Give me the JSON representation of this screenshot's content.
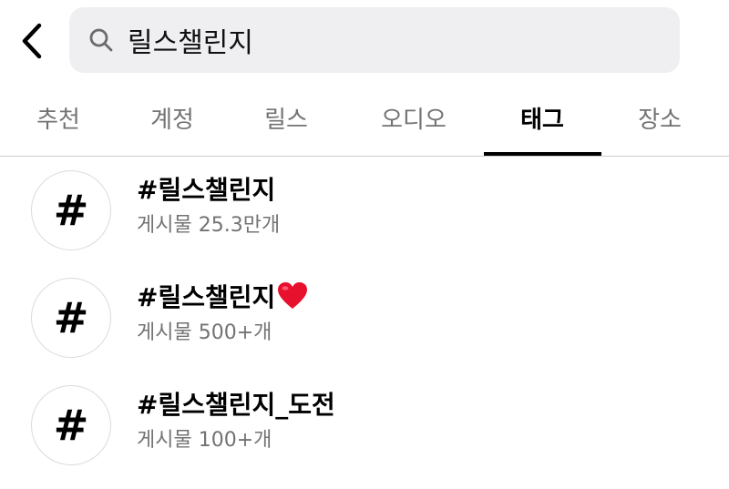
{
  "search": {
    "query": "릴스챌린지"
  },
  "tabs": [
    {
      "label": "추천",
      "active": false
    },
    {
      "label": "계정",
      "active": false
    },
    {
      "label": "릴스",
      "active": false
    },
    {
      "label": "오디오",
      "active": false
    },
    {
      "label": "태그",
      "active": true
    },
    {
      "label": "장소",
      "active": false
    }
  ],
  "results": [
    {
      "title": "#릴스챌린지",
      "posts": "게시물 25.3만개",
      "emoji": ""
    },
    {
      "title": "#릴스챌린지",
      "posts": "게시물 500+개",
      "emoji": "heart"
    },
    {
      "title": "#릴스챌린지_도전",
      "posts": "게시물 100+개",
      "emoji": ""
    }
  ],
  "hash_symbol": "#",
  "colors": {
    "search_bg": "#efeff2",
    "secondary_text": "#737373",
    "heart": "#e8112d"
  }
}
